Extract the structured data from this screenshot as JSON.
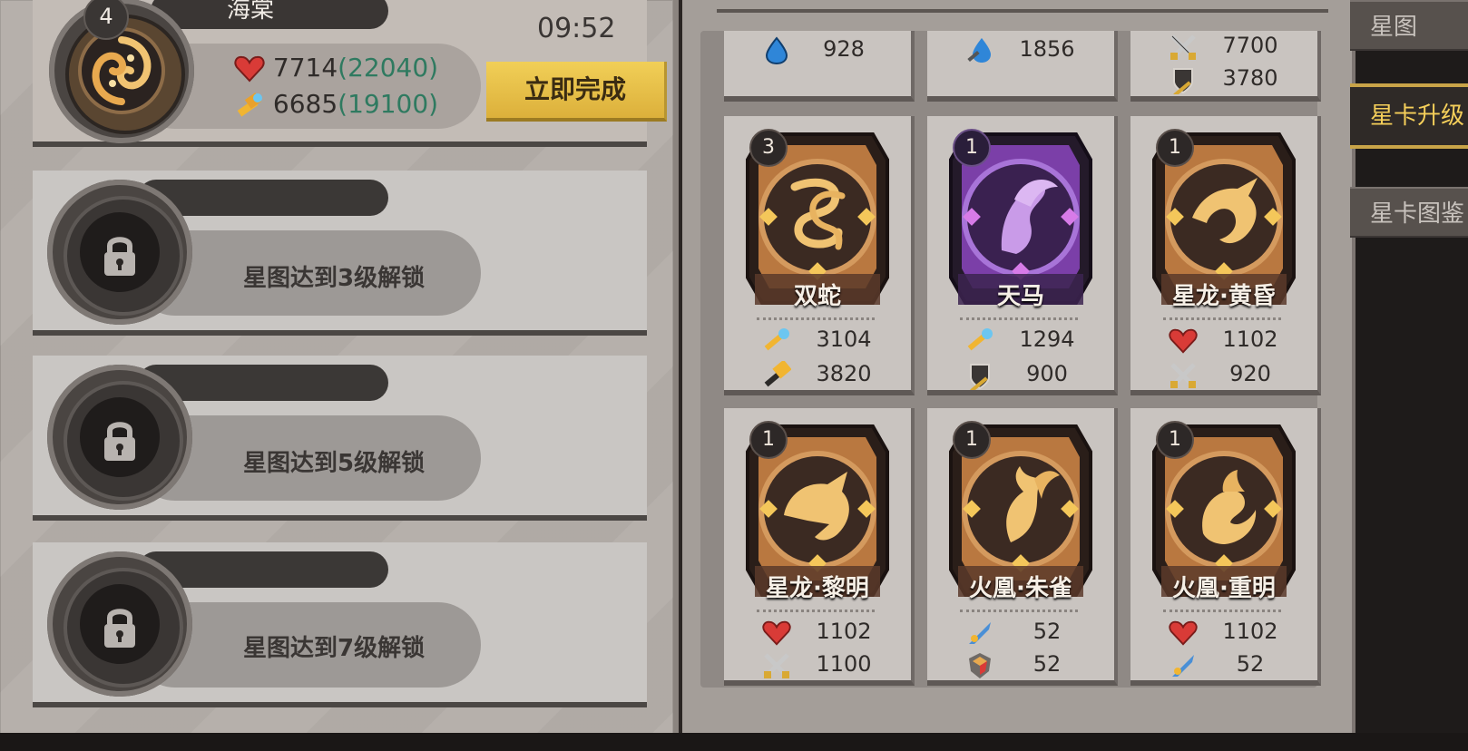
{
  "tasks": {
    "active": {
      "level": "4",
      "name": "海棠",
      "hp": "7714",
      "hp_bonus": "(22040)",
      "atk": "6685",
      "atk_bonus": "(19100)",
      "timer": "09:52",
      "finish_label": "立即完成"
    },
    "locked": [
      {
        "text": "星图达到3级解锁"
      },
      {
        "text": "星图达到5级解锁"
      },
      {
        "text": "星图达到7级解锁"
      }
    ]
  },
  "cards": {
    "top_row": [
      {
        "stats": [
          {
            "icon": "water-drop-icon",
            "value": "928"
          }
        ]
      },
      {
        "stats": [
          {
            "icon": "water-sword-icon",
            "value": "1856"
          }
        ]
      },
      {
        "stats": [
          {
            "icon": "crossed-swords-icon",
            "value": "7700"
          },
          {
            "icon": "shield-sword-icon",
            "value": "3780"
          }
        ]
      }
    ],
    "row2": [
      {
        "level": "3",
        "name": "双蛇",
        "theme": "bronze",
        "stats": [
          {
            "icon": "hammer-icon",
            "value": "3104"
          },
          {
            "icon": "gold-hammer-icon",
            "value": "3820"
          }
        ]
      },
      {
        "level": "1",
        "name": "天马",
        "theme": "purple",
        "stats": [
          {
            "icon": "hammer-icon",
            "value": "1294"
          },
          {
            "icon": "shield-sword-icon",
            "value": "900"
          }
        ]
      },
      {
        "level": "1",
        "name": "星龙·黄昏",
        "theme": "bronze",
        "stats": [
          {
            "icon": "heart-icon",
            "value": "1102"
          },
          {
            "icon": "crossed-swords-icon",
            "value": "920"
          }
        ]
      }
    ],
    "row3": [
      {
        "level": "1",
        "name": "星龙·黎明",
        "theme": "bronze",
        "stats": [
          {
            "icon": "heart-icon",
            "value": "1102"
          },
          {
            "icon": "crossed-swords-icon",
            "value": "1100"
          }
        ]
      },
      {
        "level": "1",
        "name": "火凰·朱雀",
        "theme": "bronze",
        "stats": [
          {
            "icon": "rocket-sword-icon",
            "value": "52"
          },
          {
            "icon": "crystal-shield-icon",
            "value": "52"
          }
        ]
      },
      {
        "level": "1",
        "name": "火凰·重明",
        "theme": "bronze",
        "stats": [
          {
            "icon": "heart-icon",
            "value": "1102"
          },
          {
            "icon": "rocket-sword-icon",
            "value": "52"
          }
        ]
      }
    ]
  },
  "side_tabs": [
    {
      "label": "星图"
    },
    {
      "label": "星卡升级"
    },
    {
      "label": "星卡图鉴"
    }
  ],
  "colors": {
    "accent_gold": "#f5cf5a",
    "bonus_green": "#2f7a60",
    "purple_card": "#7b3fa8",
    "bronze_card": "#b86f3a"
  }
}
